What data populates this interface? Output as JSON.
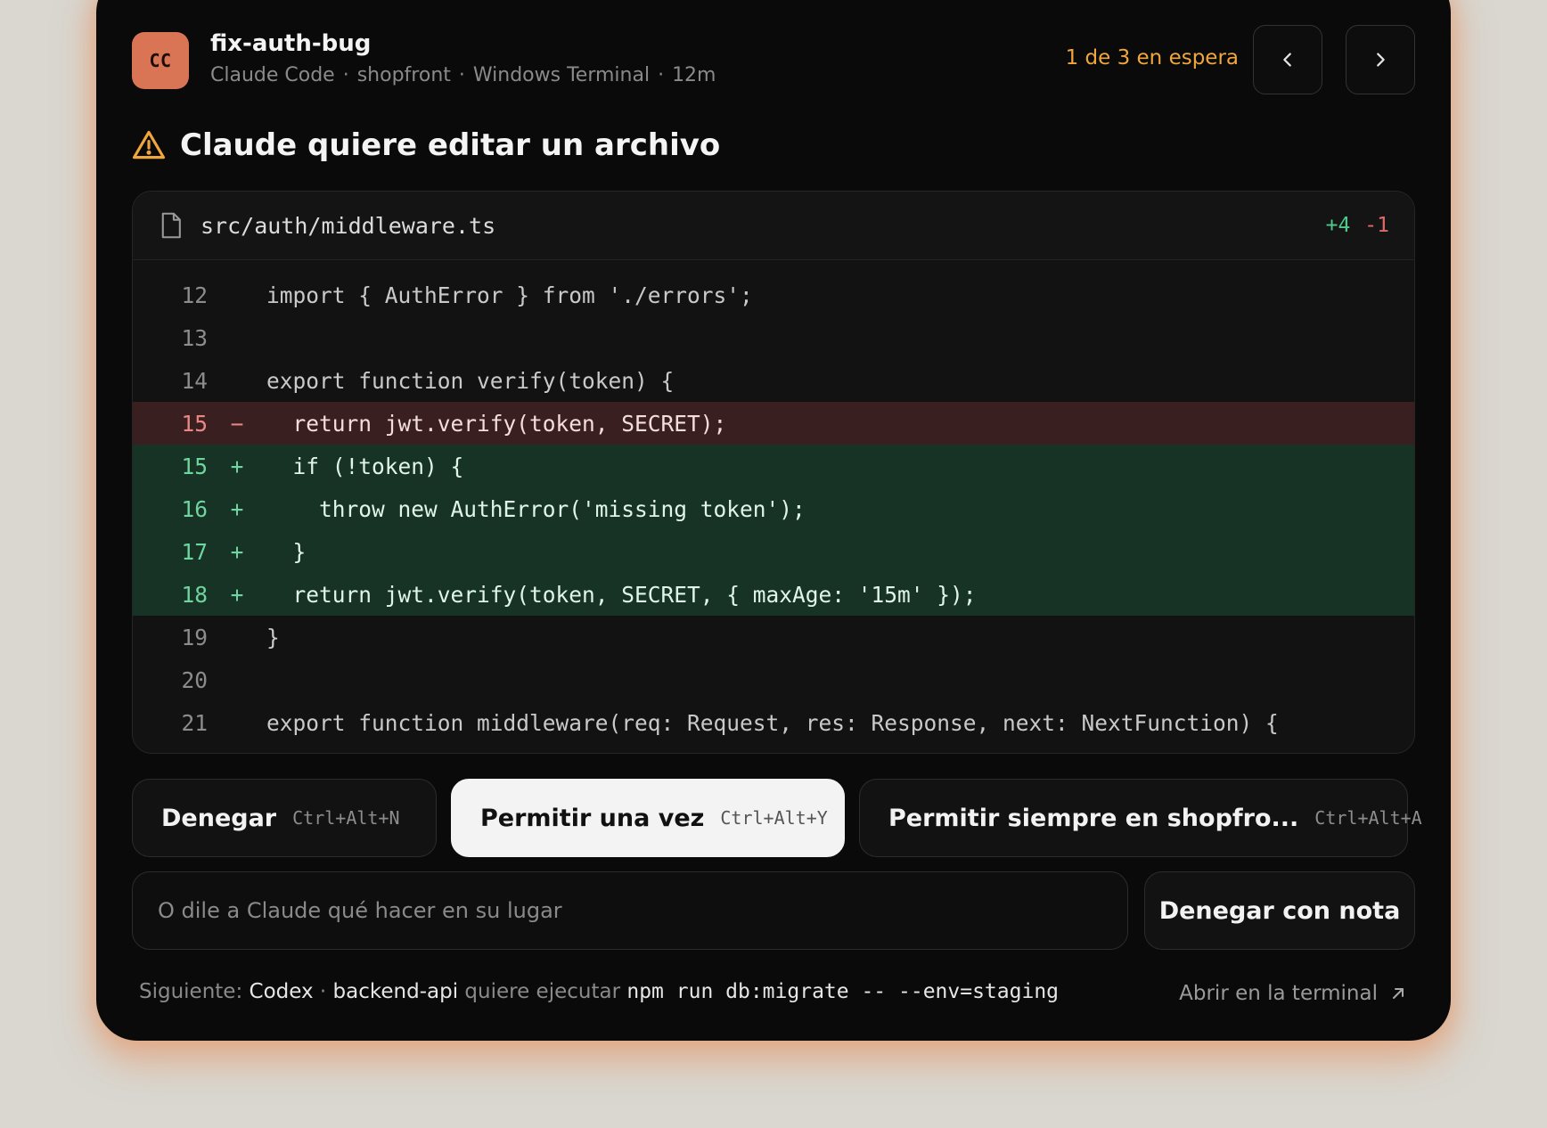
{
  "session": {
    "avatar_initials": "CC",
    "avatar_color": "#d97554",
    "title": "fix-auth-bug",
    "agent": "Claude Code",
    "project": "shopfront",
    "app": "Windows Terminal",
    "elapsed": "12m",
    "separator": "·"
  },
  "queue": {
    "status": "1 de 3 en espera",
    "color": "#f0a63c",
    "prev_icon": "chevron-left-icon",
    "next_icon": "chevron-right-icon"
  },
  "alert": {
    "icon": "warning-icon",
    "text": "Claude quiere editar un archivo"
  },
  "diff": {
    "file_icon": "file-icon",
    "path": "src/auth/middleware.ts",
    "additions": "+4",
    "deletions": "-1",
    "lines": [
      {
        "num": "12",
        "sign": "",
        "type": "context",
        "text": "import { AuthError } from './errors';"
      },
      {
        "num": "13",
        "sign": "",
        "type": "context",
        "text": ""
      },
      {
        "num": "14",
        "sign": "",
        "type": "context",
        "text": "export function verify(token) {"
      },
      {
        "num": "15",
        "sign": "−",
        "type": "del",
        "text": "  return jwt.verify(token, SECRET);"
      },
      {
        "num": "15",
        "sign": "+",
        "type": "add",
        "text": "  if (!token) {"
      },
      {
        "num": "16",
        "sign": "+",
        "type": "add",
        "text": "    throw new AuthError('missing token');"
      },
      {
        "num": "17",
        "sign": "+",
        "type": "add",
        "text": "  }"
      },
      {
        "num": "18",
        "sign": "+",
        "type": "add",
        "text": "  return jwt.verify(token, SECRET, { maxAge: '15m' });"
      },
      {
        "num": "19",
        "sign": "",
        "type": "context",
        "text": "}"
      },
      {
        "num": "20",
        "sign": "",
        "type": "context",
        "text": ""
      },
      {
        "num": "21",
        "sign": "",
        "type": "context",
        "text": "export function middleware(req: Request, res: Response, next: NextFunction) {"
      }
    ]
  },
  "actions": {
    "deny": {
      "label": "Denegar",
      "shortcut": "Ctrl+Alt+N"
    },
    "allow_once": {
      "label": "Permitir una vez",
      "shortcut": "Ctrl+Alt+Y"
    },
    "allow_always": {
      "label": "Permitir siempre en shopfro...",
      "shortcut": "Ctrl+Alt+A"
    }
  },
  "note": {
    "placeholder": "O dile a Claude qué hacer en su lugar",
    "value": "",
    "button_label": "Denegar con nota"
  },
  "footer": {
    "prefix": "Siguiente:",
    "agent": "Codex",
    "separator": "·",
    "project": "backend-api",
    "verb": "quiere ejecutar",
    "command": "npm run db:migrate -- --env=staging",
    "open_terminal": "Abrir en la terminal",
    "open_icon": "external-link-icon"
  }
}
